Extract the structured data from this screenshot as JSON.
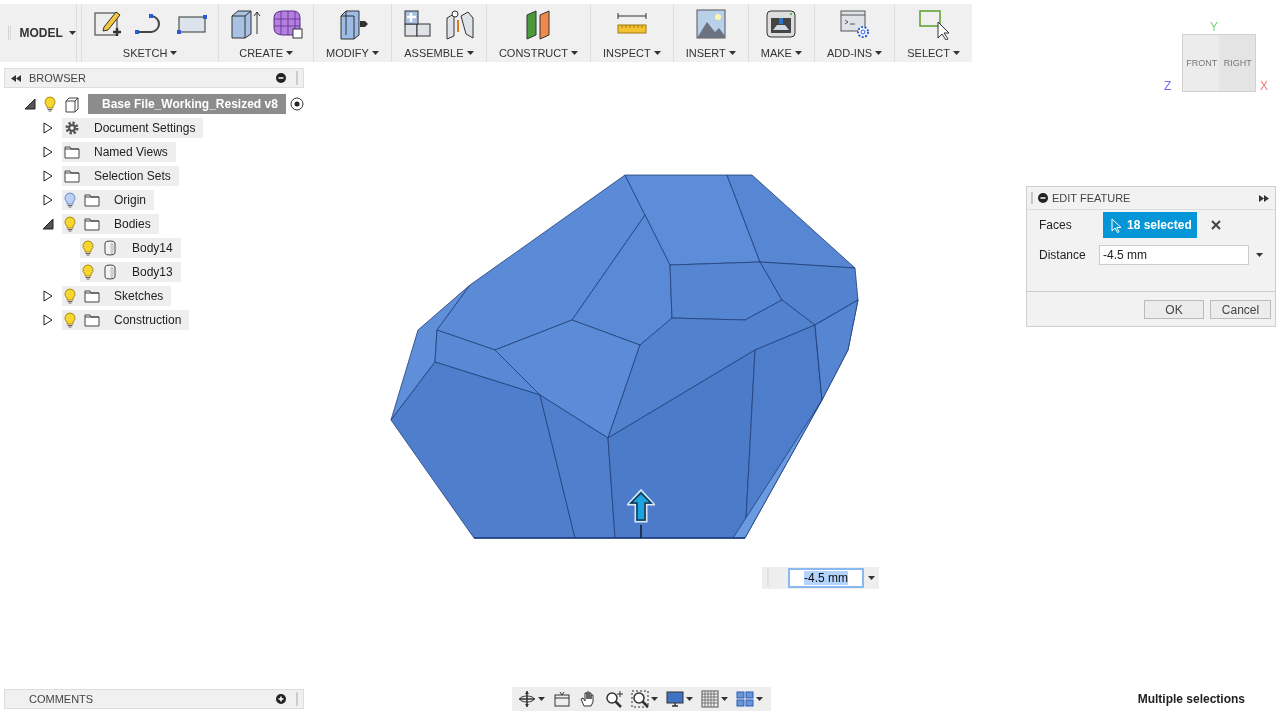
{
  "toolbar": {
    "workspace": "MODEL",
    "groups": [
      {
        "label": "SKETCH",
        "icons": [
          {
            "kind": "pencil-sketch"
          },
          {
            "kind": "line-arc"
          },
          {
            "kind": "rectangle"
          }
        ]
      },
      {
        "label": "CREATE",
        "icons": [
          {
            "kind": "box-extrude"
          },
          {
            "kind": "mesh-cube"
          }
        ]
      },
      {
        "label": "MODIFY",
        "icons": [
          {
            "kind": "press-pull"
          }
        ]
      },
      {
        "label": "ASSEMBLE",
        "icons": [
          {
            "kind": "joint-blocks"
          },
          {
            "kind": "joint-pins"
          }
        ]
      },
      {
        "label": "CONSTRUCT",
        "icons": [
          {
            "kind": "planes"
          }
        ]
      },
      {
        "label": "INSPECT",
        "icons": [
          {
            "kind": "ruler"
          }
        ]
      },
      {
        "label": "INSERT",
        "icons": [
          {
            "kind": "picture"
          }
        ]
      },
      {
        "label": "MAKE",
        "icons": [
          {
            "kind": "printer"
          }
        ]
      },
      {
        "label": "ADD-INS",
        "icons": [
          {
            "kind": "script-gear"
          }
        ]
      },
      {
        "label": "SELECT",
        "icons": [
          {
            "kind": "selection-box"
          }
        ]
      }
    ]
  },
  "browser": {
    "title": "BROWSER",
    "tree": [
      {
        "label": "Base File_Working_Resized v8",
        "kind": "component",
        "visible": true,
        "expanded": true,
        "selected": true,
        "active": true,
        "children": [
          {
            "label": "Document Settings",
            "kind": "settings",
            "expanded": false,
            "selected": false
          },
          {
            "label": "Named Views",
            "kind": "folder",
            "expanded": false,
            "selected": false
          },
          {
            "label": "Selection Sets",
            "kind": "folder",
            "expanded": false,
            "selected": false
          },
          {
            "label": "Origin",
            "kind": "folder",
            "visible": false,
            "expanded": false,
            "selected": false
          },
          {
            "label": "Bodies",
            "kind": "folder",
            "visible": true,
            "expanded": true,
            "selected": false,
            "children": [
              {
                "label": "Body14",
                "kind": "body",
                "visible": true,
                "selected": false
              },
              {
                "label": "Body13",
                "kind": "body",
                "visible": true,
                "selected": false
              }
            ]
          },
          {
            "label": "Sketches",
            "kind": "folder",
            "visible": true,
            "expanded": false,
            "selected": false
          },
          {
            "label": "Construction",
            "kind": "folder",
            "visible": true,
            "expanded": false,
            "selected": false
          }
        ]
      }
    ]
  },
  "viewcube": {
    "faces": [
      "FRONT",
      "RIGHT"
    ],
    "axes": [
      "Y",
      "Z",
      "X"
    ]
  },
  "edit_feature": {
    "title": "EDIT FEATURE",
    "faces_label": "Faces",
    "selection": "18 selected",
    "distance_label": "Distance",
    "distance": "-4.5 mm",
    "buttons": [
      "OK",
      "Cancel"
    ]
  },
  "dimension_input": {
    "value": "-4.5 mm"
  },
  "comments": {
    "title": "COMMENTS"
  },
  "nav_bar": [
    {
      "kind": "orbit",
      "dropdown": true
    },
    {
      "kind": "look-at",
      "dropdown": false
    },
    {
      "kind": "pan",
      "dropdown": false
    },
    {
      "kind": "zoom",
      "dropdown": false
    },
    {
      "kind": "fit",
      "dropdown": true
    },
    {
      "kind": "display",
      "dropdown": true
    },
    {
      "kind": "grid",
      "dropdown": true
    },
    {
      "kind": "viewports",
      "dropdown": true
    }
  ],
  "status": "Multiple selections"
}
